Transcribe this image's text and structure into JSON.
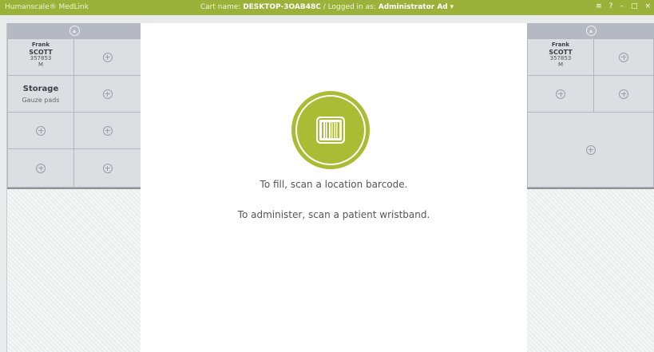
{
  "titlebar": {
    "brand": "Humanscale® MedLink",
    "cart_label": "Cart name:",
    "cart_name": "DESKTOP-3OAB48C",
    "separator": "/",
    "logged_label": "Logged in as:",
    "user": "Administrator Ad",
    "user_caret": "▾",
    "menu_icon": "≡",
    "help_icon": "?",
    "minimize_icon": "–",
    "restore_icon": "□",
    "close_icon": "×"
  },
  "left_cart": {
    "up_icon": "▴",
    "patient": {
      "first": "Frank",
      "last": "SCOTT",
      "id": "357853",
      "sex": "M"
    },
    "storage": {
      "title": "Storage",
      "item": "Gauze pads"
    }
  },
  "right_cart": {
    "up_icon": "▴",
    "patient": {
      "first": "Frank",
      "last": "SCOTT",
      "id": "357853",
      "sex": "M"
    }
  },
  "main": {
    "scan_icon": "barcode-icon",
    "accent_color": "#a8bc34",
    "fill_message": "To fill, scan a location barcode.",
    "administer_message": "To administer, scan a patient wristband."
  }
}
